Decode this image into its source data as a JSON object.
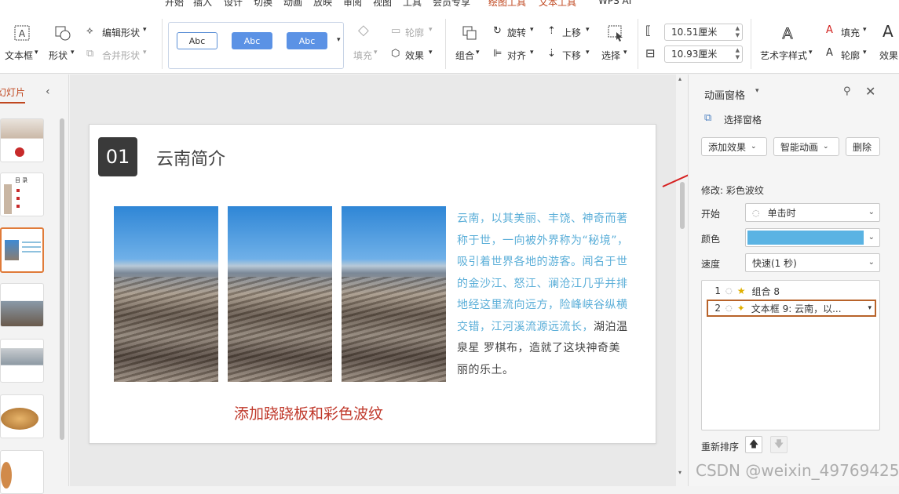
{
  "menubar": {
    "items": [
      "开始",
      "插入",
      "设计",
      "切换",
      "动画",
      "放映",
      "审阅",
      "视图",
      "工具",
      "会员专享",
      "绘图工具",
      "文本工具",
      "WPS AI"
    ],
    "active": "绘图工具"
  },
  "ribbon": {
    "textbox": "文本框",
    "shape": "形状",
    "edit_shape": "编辑形状",
    "merge_shape": "合并形状",
    "style_samples": [
      "Abc",
      "Abc",
      "Abc"
    ],
    "fill": "填充",
    "outline": "轮廓",
    "effect": "效果",
    "group": "组合",
    "rotate": "旋转",
    "align": "对齐",
    "bring_forward": "上移",
    "send_backward": "下移",
    "select": "选择",
    "height_value": "10.51厘米",
    "width_value": "10.93厘米",
    "art_style": "艺术字样式",
    "text_fill": "填充",
    "text_outline": "轮廓",
    "text_effect": "效果"
  },
  "thumbs": {
    "header": "幻灯片",
    "thumb2_title": "目 录"
  },
  "slide": {
    "number": "01",
    "title": "云南简介",
    "body_highlight": "云南，以其美丽、丰饶、神奇而著称于世，一向被外界称为“秘境”，吸引着世界各地的游客。闻名于世的金沙江、怒江、澜沧江几乎并排地经这里流向远方，险峰峡谷纵横交错，江河溪流源远流长，",
    "body_rest": "湖泊温泉星 罗棋布，造就了这块神奇美丽的乐土。",
    "caption": "添加跷跷板和彩色波纹"
  },
  "anim_pane": {
    "title": "动画窗格",
    "select_pane": "选择窗格",
    "add_effect": "添加效果",
    "smart_anim": "智能动画",
    "delete": "删除",
    "modify_label": "修改: 彩色波纹",
    "start_label": "开始",
    "start_value": "单击时",
    "color_label": "颜色",
    "color_value": "#5ab3e3",
    "speed_label": "速度",
    "speed_value": "快速(1 秒)",
    "items": [
      {
        "index": "1",
        "name": "组合 8"
      },
      {
        "index": "2",
        "name": "文本框 9: 云南，以..."
      }
    ],
    "reorder_label": "重新排序"
  },
  "watermark": "CSDN @weixin_49769425",
  "colors": {
    "accent": "#c0471f",
    "highlight_text": "#5aaed8",
    "caption": "#c0392b",
    "selection": "#b8632a"
  }
}
